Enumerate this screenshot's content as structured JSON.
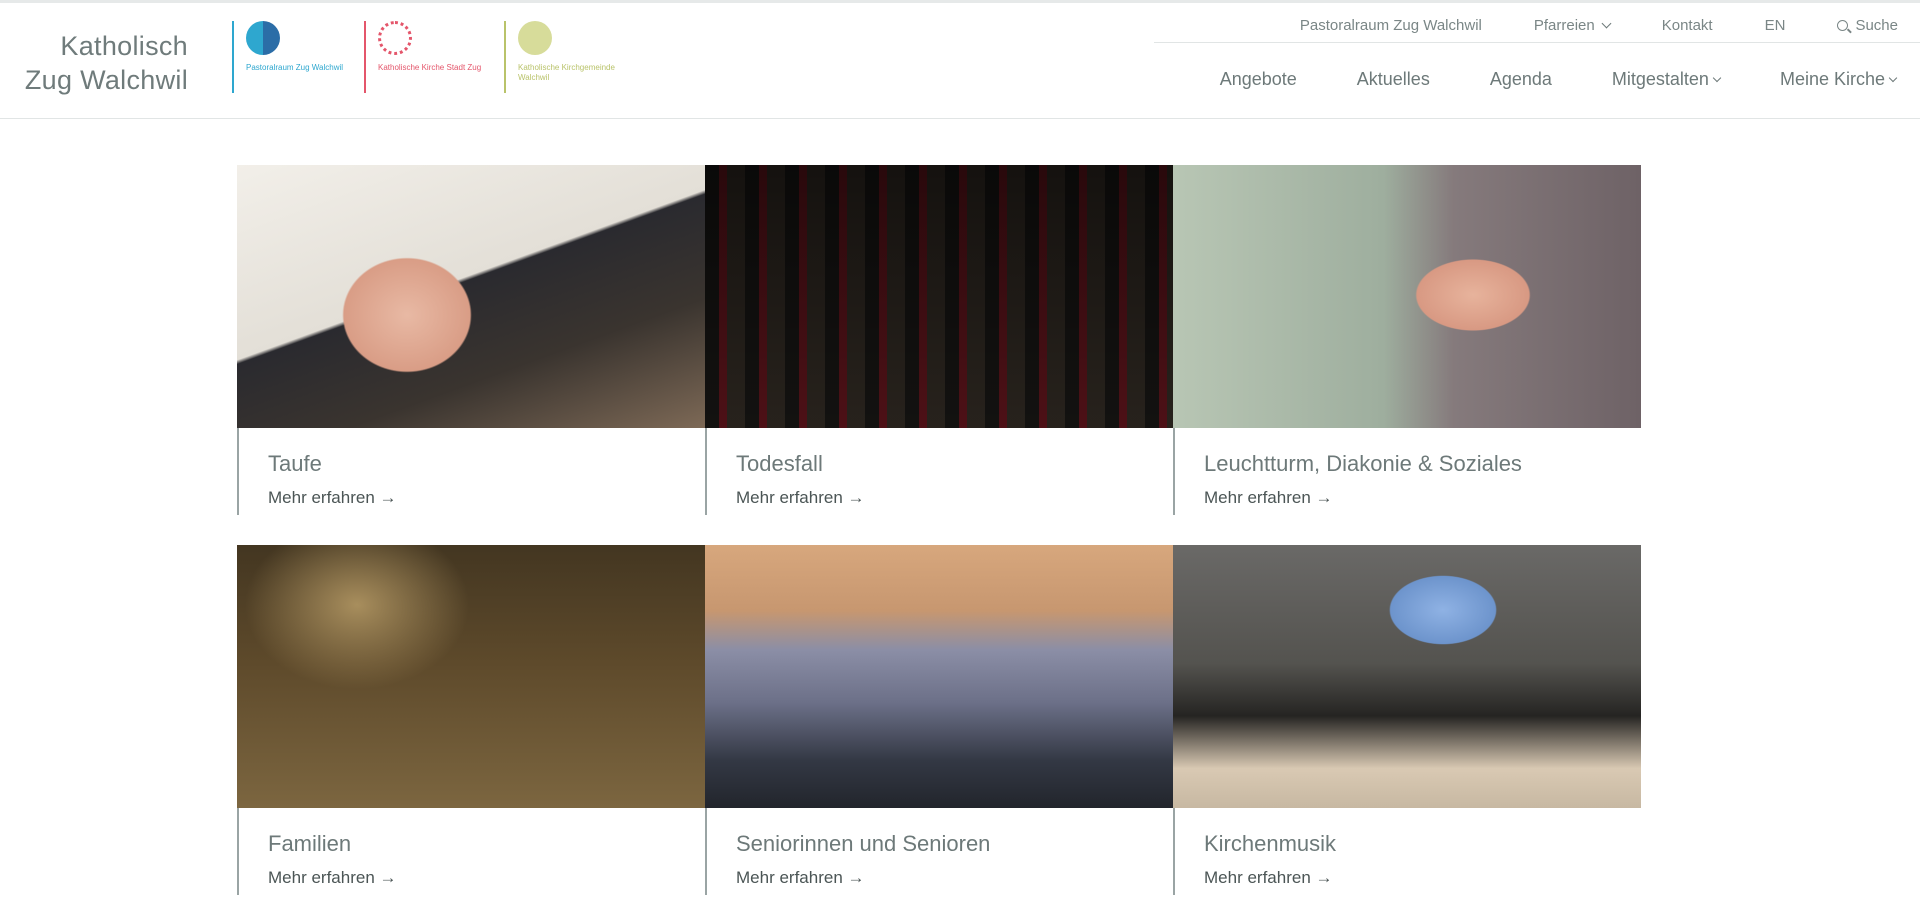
{
  "header": {
    "brand": {
      "line1": "Katholisch",
      "line2": "Zug Walchwil"
    },
    "logos": [
      {
        "caption": "Pastoralraum Zug Walchwil",
        "color": "#2ea7cf"
      },
      {
        "caption": "Katholische Kirche Stadt Zug",
        "color": "#e4566b"
      },
      {
        "caption": "Katholische Kirchgemeinde Walchwil",
        "color": "#b9c36a"
      }
    ],
    "utility": {
      "pastoralraum": "Pastoralraum Zug Walchwil",
      "pfarreien": "Pfarreien",
      "kontakt": "Kontakt",
      "lang": "EN",
      "suche": "Suche"
    },
    "nav": {
      "angebote": "Angebote",
      "aktuelles": "Aktuelles",
      "agenda": "Agenda",
      "mitgestalten": "Mitgestalten",
      "meine_kirche": "Meine Kirche"
    }
  },
  "cards": [
    {
      "title": "Taufe",
      "link": "Mehr erfahren →"
    },
    {
      "title": "Todesfall",
      "link": "Mehr erfahren →"
    },
    {
      "title": "Leuchtturm, Diakonie & Soziales",
      "link": "Mehr erfahren →"
    },
    {
      "title": "Familien",
      "link": "Mehr erfahren →"
    },
    {
      "title": "Seniorinnen und Senioren",
      "link": "Mehr erfahren →"
    },
    {
      "title": "Kirchenmusik",
      "link": "Mehr erfahren →"
    }
  ],
  "colors": {
    "text": "#6d7979",
    "rule": "#9aa4a4",
    "link": "#4b5555"
  }
}
